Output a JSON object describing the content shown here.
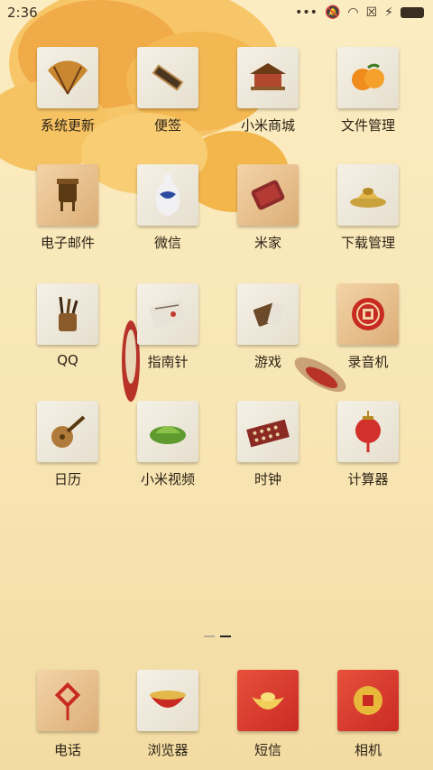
{
  "status_bar": {
    "time": "2:36"
  },
  "apps": [
    {
      "label": "系统更新",
      "icon": "fan-icon"
    },
    {
      "label": "便签",
      "icon": "scroll-icon"
    },
    {
      "label": "小米商城",
      "icon": "pavilion-icon"
    },
    {
      "label": "文件管理",
      "icon": "orange-icon"
    },
    {
      "label": "电子邮件",
      "icon": "bronze-vessel-icon"
    },
    {
      "label": "微信",
      "icon": "porcelain-vase-icon"
    },
    {
      "label": "米家",
      "icon": "red-package-icon"
    },
    {
      "label": "下载管理",
      "icon": "gold-ingot-plate-icon"
    },
    {
      "label": "QQ",
      "icon": "brush-pot-icon"
    },
    {
      "label": "指南针",
      "icon": "paper-icon"
    },
    {
      "label": "游戏",
      "icon": "game-box-icon"
    },
    {
      "label": "录音机",
      "icon": "red-seal-icon"
    },
    {
      "label": "日历",
      "icon": "pipa-icon"
    },
    {
      "label": "小米视频",
      "icon": "dumpling-icon"
    },
    {
      "label": "时钟",
      "icon": "abacus-icon"
    },
    {
      "label": "计算器",
      "icon": "lantern-icon"
    }
  ],
  "dock": [
    {
      "label": "电话",
      "icon": "chinese-knot-icon"
    },
    {
      "label": "浏览器",
      "icon": "bowl-icon"
    },
    {
      "label": "短信",
      "icon": "gold-ingot-icon"
    },
    {
      "label": "相机",
      "icon": "coin-icon"
    }
  ],
  "colors": {
    "background": "#f8e6b4",
    "label": "#2d2317",
    "accent_red": "#c92b23"
  }
}
